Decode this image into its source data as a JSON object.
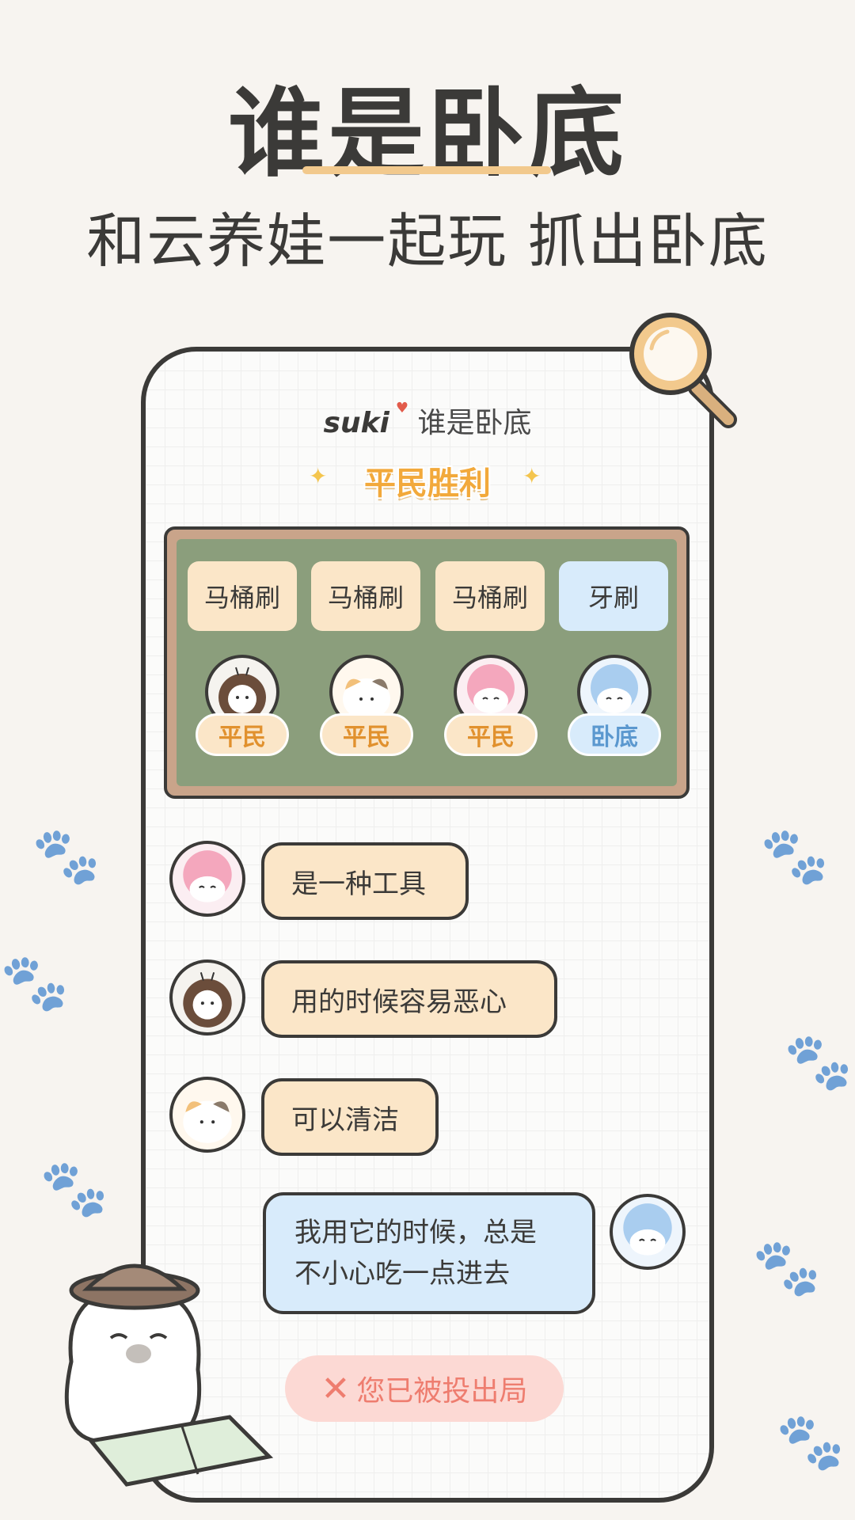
{
  "hero": {
    "title": "谁是卧底",
    "subtitle": "和云养娃一起玩 抓出卧底"
  },
  "app": {
    "brand": "suki",
    "title": "谁是卧底",
    "result": "平民胜利"
  },
  "board": {
    "players": [
      {
        "word": "马桶刷",
        "role": "平民",
        "avatar": "bee-costume-avatar"
      },
      {
        "word": "马桶刷",
        "role": "平民",
        "avatar": "calico-cat-avatar"
      },
      {
        "word": "马桶刷",
        "role": "平民",
        "avatar": "pink-hair-avatar"
      },
      {
        "word": "牙刷",
        "role": "卧底",
        "avatar": "blue-hair-avatar"
      }
    ]
  },
  "chat": [
    {
      "text": "是一种工具",
      "avatar": "pink-hair-avatar"
    },
    {
      "text": "用的时候容易恶心",
      "avatar": "bee-costume-avatar"
    },
    {
      "text": "可以清洁",
      "avatar": "calico-cat-avatar"
    },
    {
      "line1": "我用它的时候，总是",
      "line2": "不小心吃一点进去",
      "avatar": "blue-hair-avatar",
      "mine": true
    }
  ],
  "status": {
    "eliminated": "您已被投出局",
    "icon": "close-icon"
  },
  "colors": {
    "accent": "#f2a93b",
    "civilian_card": "#fbe6c8",
    "spy_card": "#d8ebfb",
    "board": "#8b9e7c",
    "eliminated_bg": "#fcd9d4"
  }
}
